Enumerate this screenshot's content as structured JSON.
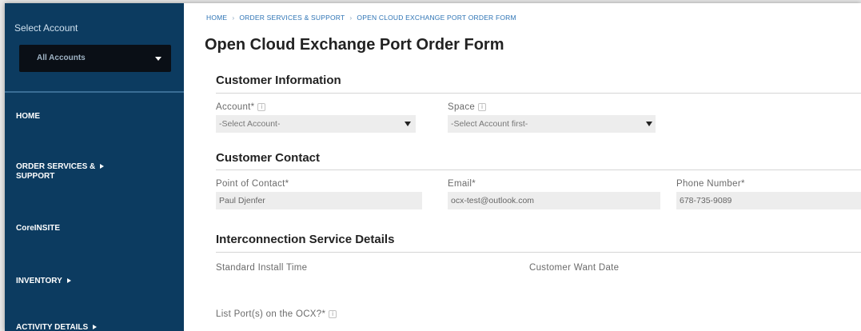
{
  "sidebar": {
    "select_account_label": "Select Account",
    "account_dropdown_value": "All Accounts",
    "nav": {
      "home": "HOME",
      "order_services_line1": "ORDER SERVICES &",
      "order_services_line2": "SUPPORT",
      "coreinsite": "CoreINSITE",
      "inventory": "INVENTORY",
      "activity_details": "ACTIVITY DETAILS"
    }
  },
  "breadcrumb": {
    "home": "HOME",
    "order_services": "ORDER SERVICES & SUPPORT",
    "current": "OPEN CLOUD EXCHANGE PORT ORDER FORM"
  },
  "page_title": "Open Cloud Exchange Port Order Form",
  "customer_information": {
    "heading": "Customer Information",
    "account_label": "Account*",
    "account_value": "-Select Account-",
    "space_label": "Space",
    "space_value": "-Select Account first-"
  },
  "customer_contact": {
    "heading": "Customer Contact",
    "poc_label": "Point of Contact*",
    "poc_value": "Paul Djenfer",
    "email_label": "Email*",
    "email_value": "ocx-test@outlook.com",
    "phone_label": "Phone Number*",
    "phone_value": "678-735-9089"
  },
  "interconnection": {
    "heading": "Interconnection Service Details",
    "standard_install_label": "Standard Install Time",
    "customer_want_date_label": "Customer Want Date",
    "list_ports_label": "List Port(s) on the OCX?*"
  },
  "icons": {
    "info": "i"
  }
}
